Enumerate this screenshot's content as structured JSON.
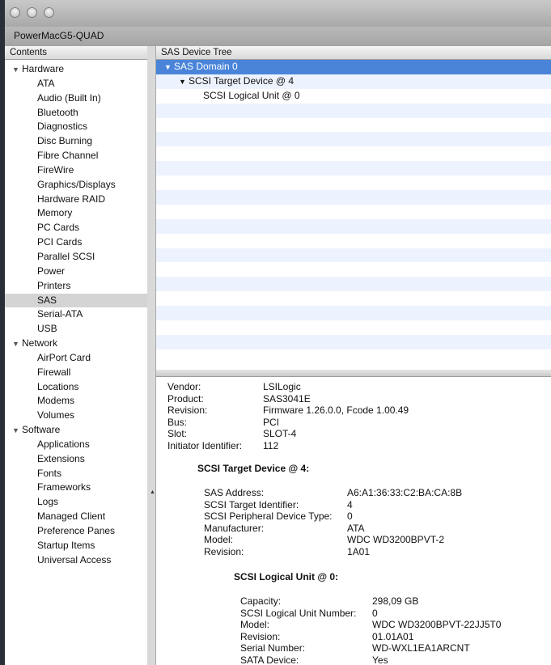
{
  "window": {
    "machine_name": "PowerMacG5-QUAD"
  },
  "sidebar": {
    "header": "Contents",
    "rows": [
      {
        "kind": "cat",
        "label": "Hardware"
      },
      {
        "kind": "item",
        "label": "ATA"
      },
      {
        "kind": "item",
        "label": "Audio (Built In)"
      },
      {
        "kind": "item",
        "label": "Bluetooth"
      },
      {
        "kind": "item",
        "label": "Diagnostics"
      },
      {
        "kind": "item",
        "label": "Disc Burning"
      },
      {
        "kind": "item",
        "label": "Fibre Channel"
      },
      {
        "kind": "item",
        "label": "FireWire"
      },
      {
        "kind": "item",
        "label": "Graphics/Displays"
      },
      {
        "kind": "item",
        "label": "Hardware RAID"
      },
      {
        "kind": "item",
        "label": "Memory"
      },
      {
        "kind": "item",
        "label": "PC Cards"
      },
      {
        "kind": "item",
        "label": "PCI Cards"
      },
      {
        "kind": "item",
        "label": "Parallel SCSI"
      },
      {
        "kind": "item",
        "label": "Power"
      },
      {
        "kind": "item",
        "label": "Printers"
      },
      {
        "kind": "item",
        "label": "SAS",
        "selected": true
      },
      {
        "kind": "item",
        "label": "Serial-ATA"
      },
      {
        "kind": "item",
        "label": "USB"
      },
      {
        "kind": "cat",
        "label": "Network"
      },
      {
        "kind": "item",
        "label": "AirPort Card"
      },
      {
        "kind": "item",
        "label": "Firewall"
      },
      {
        "kind": "item",
        "label": "Locations"
      },
      {
        "kind": "item",
        "label": "Modems"
      },
      {
        "kind": "item",
        "label": "Volumes"
      },
      {
        "kind": "cat",
        "label": "Software"
      },
      {
        "kind": "item",
        "label": "Applications"
      },
      {
        "kind": "item",
        "label": "Extensions"
      },
      {
        "kind": "item",
        "label": "Fonts"
      },
      {
        "kind": "item",
        "label": "Frameworks"
      },
      {
        "kind": "item",
        "label": "Logs"
      },
      {
        "kind": "item",
        "label": "Managed Client"
      },
      {
        "kind": "item",
        "label": "Preference Panes"
      },
      {
        "kind": "item",
        "label": "Startup Items"
      },
      {
        "kind": "item",
        "label": "Universal Access"
      }
    ]
  },
  "device_tree": {
    "header": "SAS Device Tree",
    "rows": [
      {
        "label": "SAS Domain 0",
        "level": 0,
        "expanded": true,
        "selected": true
      },
      {
        "label": "SCSI Target Device @ 4",
        "level": 1,
        "expanded": true
      },
      {
        "label": "SCSI Logical Unit @ 0",
        "level": 2
      }
    ]
  },
  "details": {
    "controller": [
      {
        "k": "Vendor:",
        "v": "LSILogic"
      },
      {
        "k": "Product:",
        "v": "SAS3041E"
      },
      {
        "k": "Revision:",
        "v": "Firmware 1.26.0.0, Fcode 1.00.49"
      },
      {
        "k": "Bus:",
        "v": "PCI"
      },
      {
        "k": "Slot:",
        "v": "SLOT-4"
      },
      {
        "k": "Initiator Identifier:",
        "v": "112"
      }
    ],
    "target_title": "SCSI Target Device @ 4:",
    "target": [
      {
        "k": "SAS Address:",
        "v": "A6:A1:36:33:C2:BA:CA:8B"
      },
      {
        "k": "SCSI Target Identifier:",
        "v": "4"
      },
      {
        "k": "SCSI Peripheral Device Type:",
        "v": "0"
      },
      {
        "k": "Manufacturer:",
        "v": "ATA"
      },
      {
        "k": "Model:",
        "v": "WDC WD3200BPVT-2"
      },
      {
        "k": "Revision:",
        "v": "1A01"
      }
    ],
    "unit_title": "SCSI Logical Unit @ 0:",
    "unit": [
      {
        "k": "Capacity:",
        "v": "298,09 GB"
      },
      {
        "k": "SCSI Logical Unit Number:",
        "v": "0"
      },
      {
        "k": "Model:",
        "v": "WDC WD3200BPVT-22JJ5T0"
      },
      {
        "k": "Revision:",
        "v": "01.01A01"
      },
      {
        "k": "Serial Number:",
        "v": "WD-WXL1EA1ARCNT"
      },
      {
        "k": "SATA Device:",
        "v": "Yes"
      }
    ]
  }
}
